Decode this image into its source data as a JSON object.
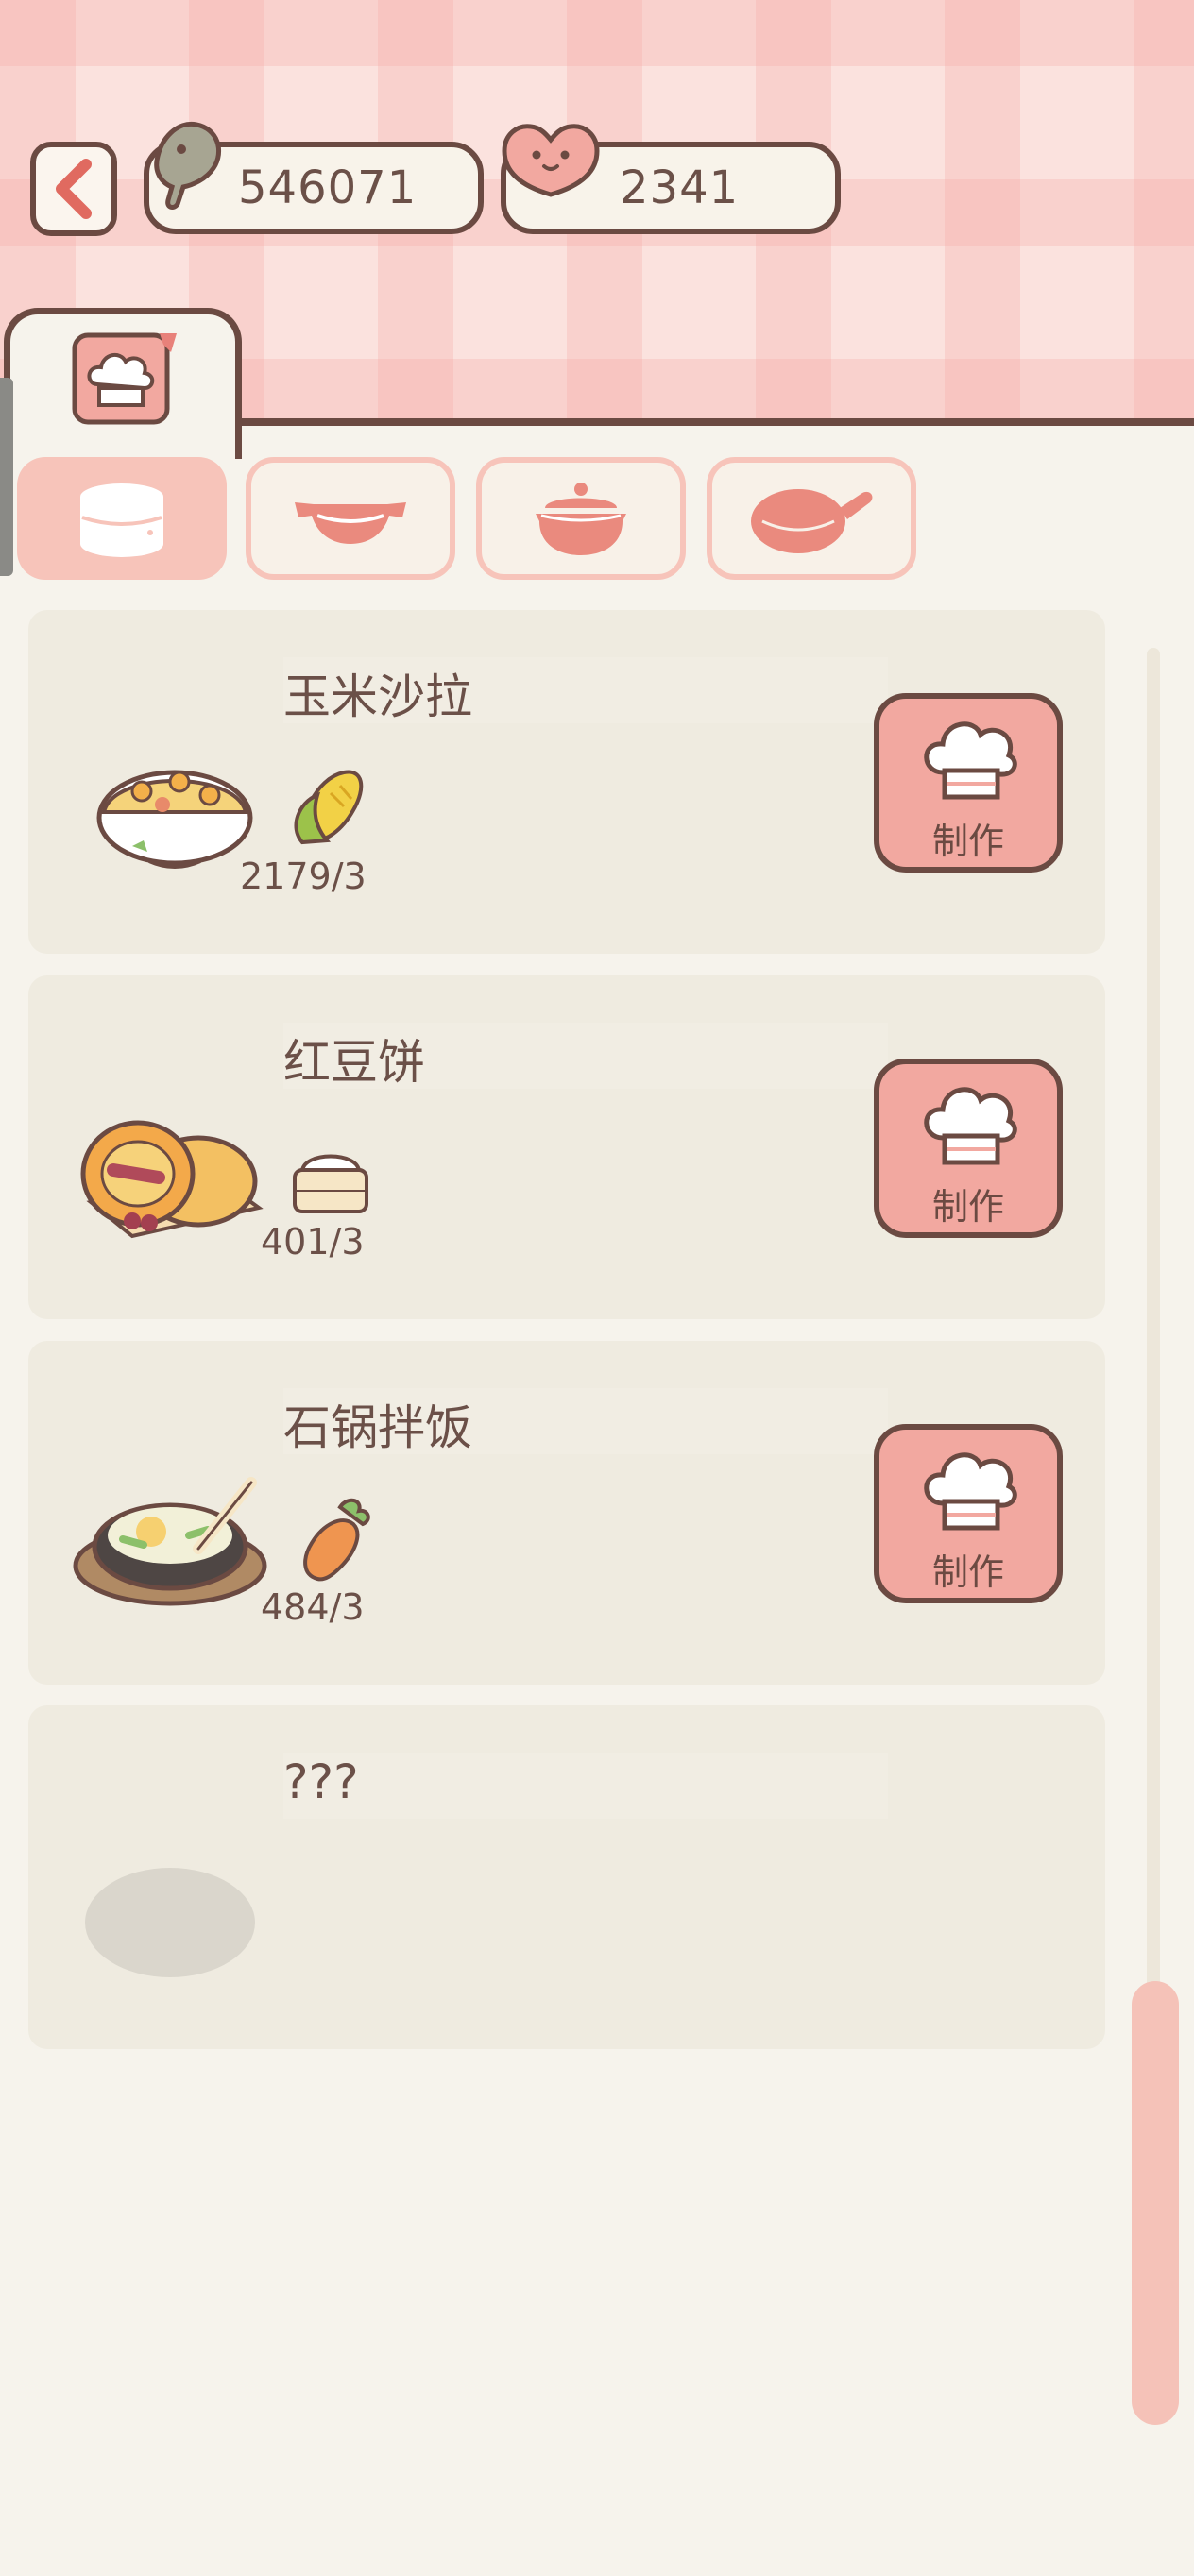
{
  "currency": {
    "fish": "546071",
    "hearts": "2341"
  },
  "categories": [
    {
      "icon": "steamer-icon",
      "active": true
    },
    {
      "icon": "wok-icon",
      "active": false
    },
    {
      "icon": "clay-pot-icon",
      "active": false
    },
    {
      "icon": "frying-pan-icon",
      "active": false
    }
  ],
  "recipes": [
    {
      "name": "玉米沙拉",
      "ingredient_icon": "corn-icon",
      "count": "2179/3",
      "button": "制作"
    },
    {
      "name": "红豆饼",
      "ingredient_icon": "rice-flour-icon",
      "count": "401/3",
      "button": "制作"
    },
    {
      "name": "石锅拌饭",
      "ingredient_icon": "carrot-icon",
      "count": "484/3",
      "button": "制作"
    },
    {
      "name": "???"
    }
  ],
  "colors": {
    "accent": "#f2a8a0",
    "outline": "#6b4a42",
    "card": "#efebe0",
    "background": "#f6f3ec"
  }
}
